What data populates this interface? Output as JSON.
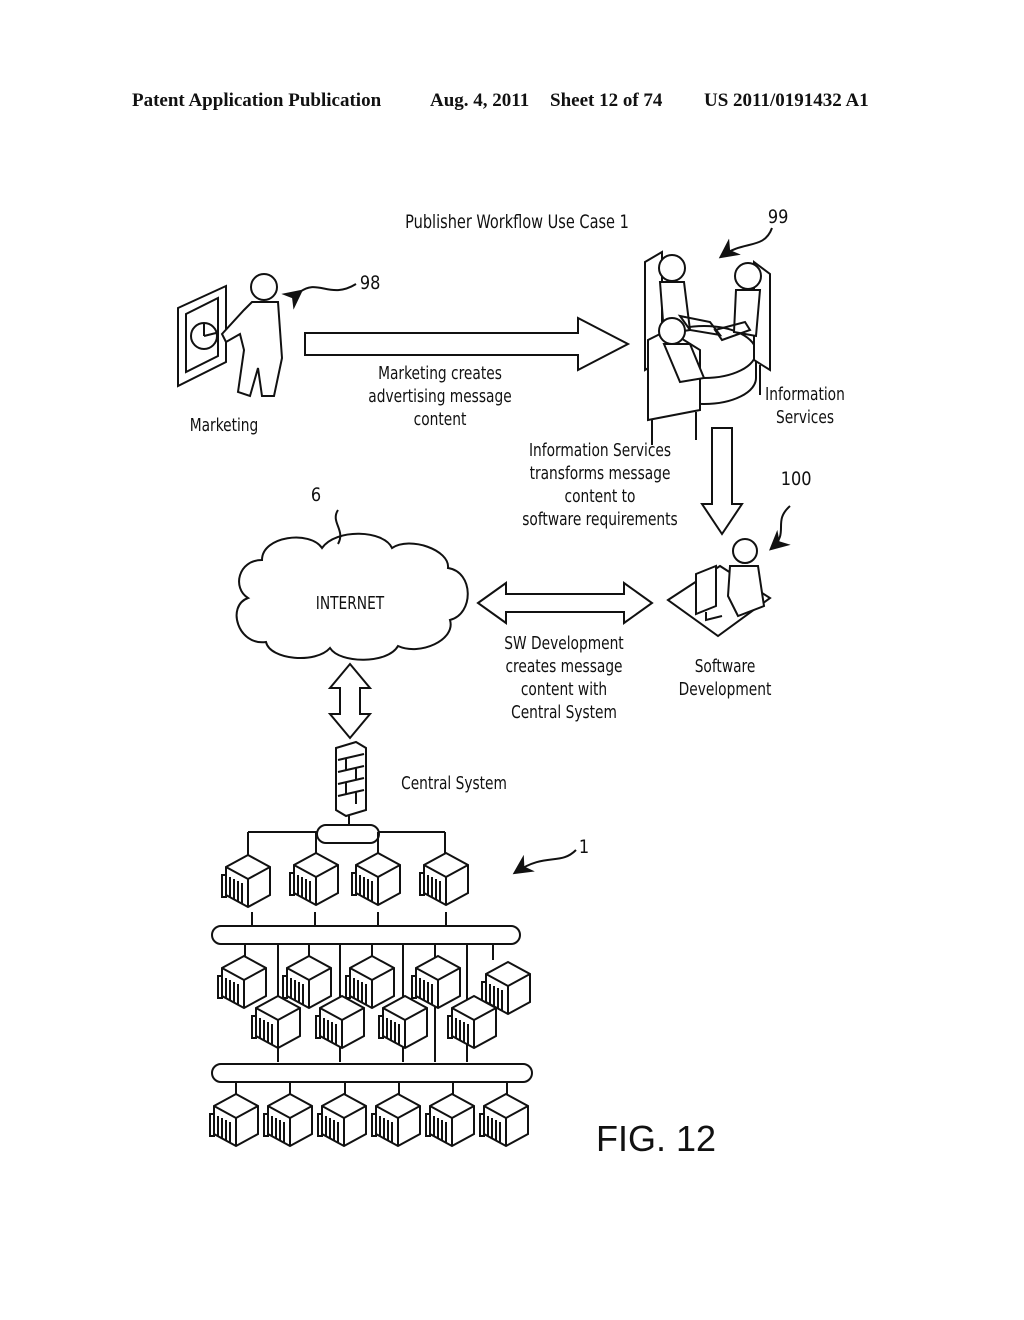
{
  "header": {
    "left": "Patent Application Publication",
    "date": "Aug. 4, 2011",
    "sheet": "Sheet 12 of 74",
    "number": "US 2011/0191432 A1"
  },
  "title": "Publisher Workflow Use Case 1",
  "nodes": {
    "marketing": {
      "label": "Marketing",
      "ref": "98",
      "icon": "presenter-icon"
    },
    "info_services": {
      "label_lines": [
        "Information",
        "Services"
      ],
      "ref": "99",
      "icon": "meeting-table-icon"
    },
    "sw_dev": {
      "label_lines": [
        "Software",
        "Development"
      ],
      "ref": "100",
      "icon": "developer-workstation-icon"
    },
    "internet": {
      "label": "INTERNET",
      "ref": "6",
      "icon": "cloud-icon"
    },
    "central_system": {
      "label": "Central System",
      "ref": "1",
      "icon": "firewall-icon"
    }
  },
  "edges": {
    "marketing_to_is": {
      "lines": [
        "Marketing creates",
        "advertising message",
        "content"
      ]
    },
    "is_to_sw": {
      "lines": [
        "Information Services",
        "transforms message",
        "content to",
        "software requirements"
      ]
    },
    "sw_internet": {
      "lines": [
        "SW Development",
        "creates message",
        "content with",
        "Central System"
      ]
    }
  },
  "figure_label": "FIG. 12"
}
